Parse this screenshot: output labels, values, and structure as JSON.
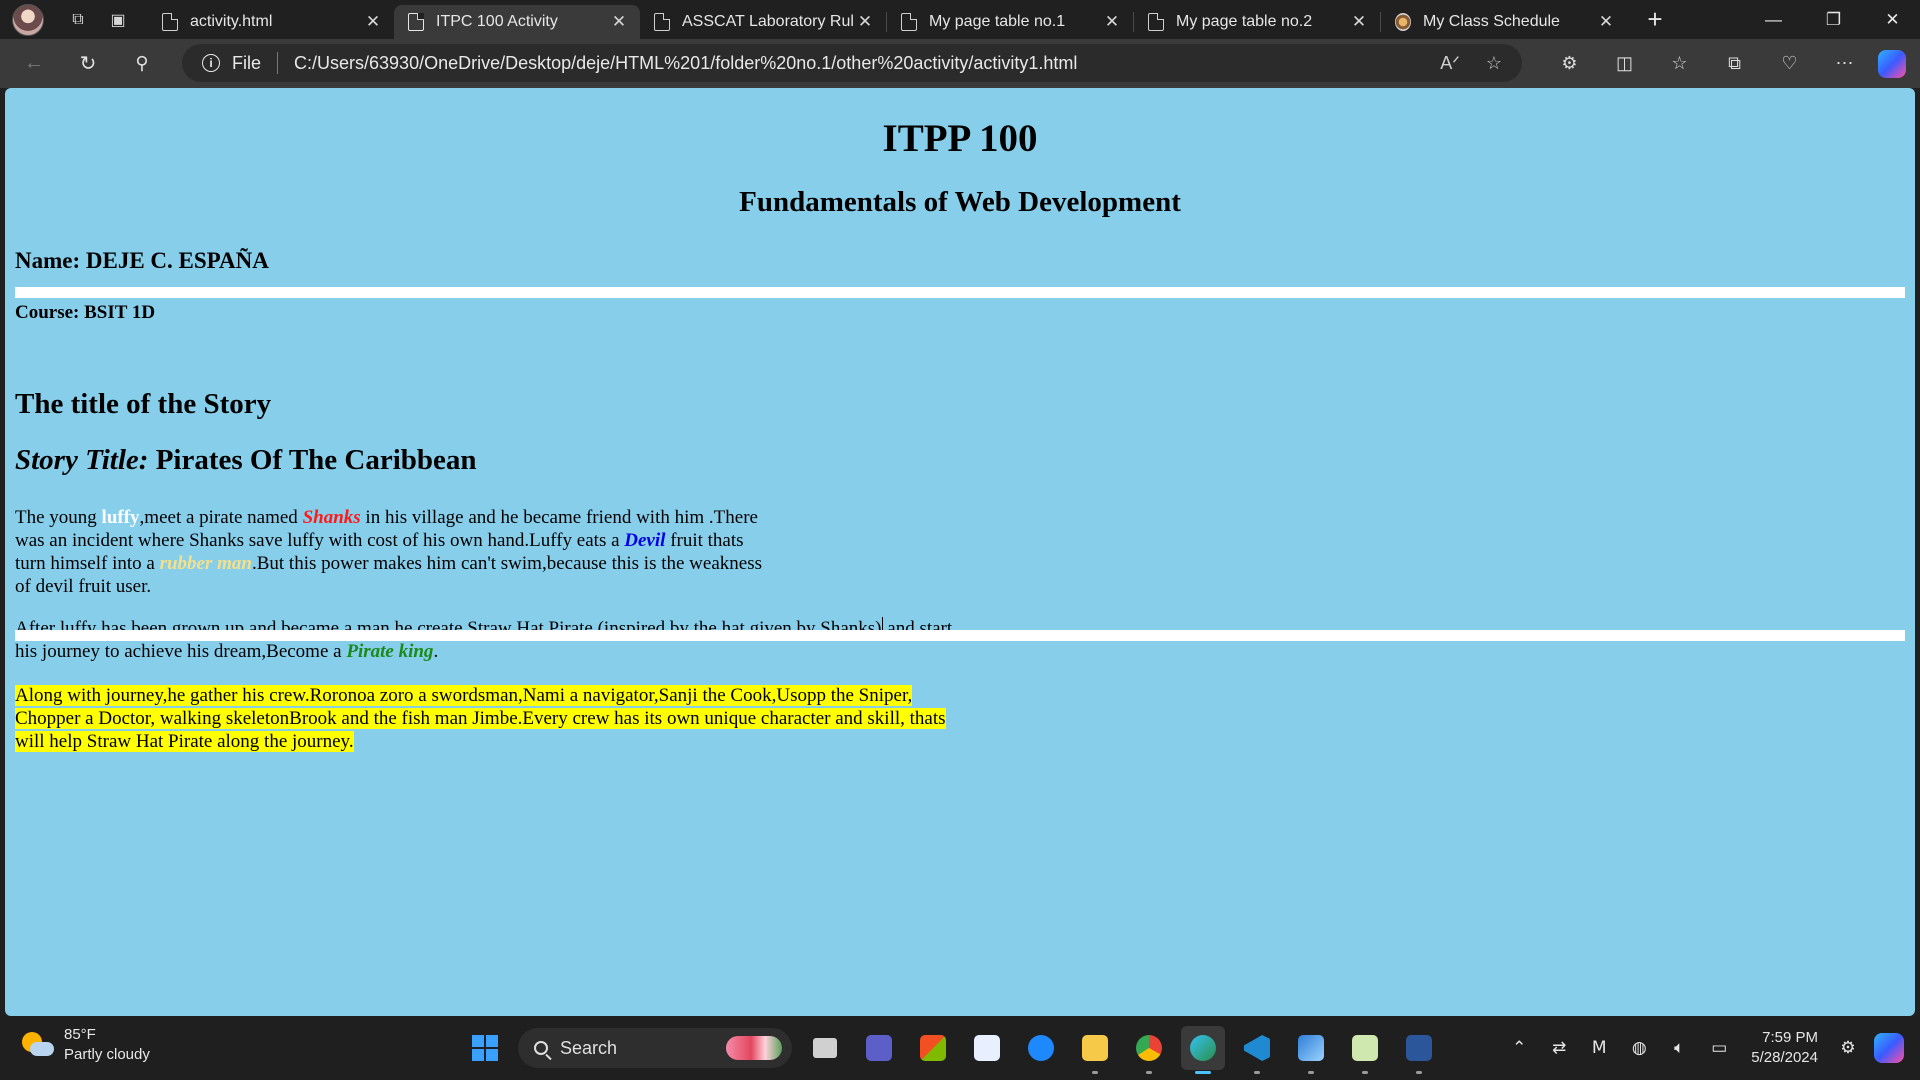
{
  "browser": {
    "tabs": [
      {
        "title": "activity.html",
        "active": false,
        "icon": "page-icon"
      },
      {
        "title": "ITPC 100 Activity",
        "active": true,
        "icon": "page-icon"
      },
      {
        "title": "ASSCAT Laboratory Rules",
        "active": false,
        "icon": "page-icon"
      },
      {
        "title": "My page table no.1",
        "active": false,
        "icon": "page-icon"
      },
      {
        "title": "My page table no.2",
        "active": false,
        "icon": "page-icon"
      },
      {
        "title": "My Class Schedule",
        "active": false,
        "icon": "globe-icon"
      }
    ],
    "address": {
      "scheme_label": "File",
      "url": "C:/Users/63930/OneDrive/Desktop/deje/HTML%201/folder%20no.1/other%20activity/activity1.html"
    }
  },
  "page": {
    "heading": "ITPP 100",
    "subheading": "Fundamentals of Web Development",
    "name_line": "Name: DEJE C. ESPAÑA",
    "course_line": "Course: BSIT 1D",
    "section_title": "The title of the Story",
    "story_title_label": "Story Title:",
    "story_title": "Pirates Of The Caribbean",
    "para1": {
      "t1": "The young ",
      "luffy": "luffy",
      "t2": ",meet a pirate named ",
      "shanks": "Shanks",
      "t3": " in his village and he became friend with him .There was an incident where Shanks save luffy with cost of his own hand.Luffy eats a ",
      "devil": "Devil",
      "t4": " fruit thats turn himself into a ",
      "rubber": "rubber man",
      "t5": ".But this power makes him can't swim,because this is the weakness of devil fruit user."
    },
    "para2": {
      "t1": "After luffy has been grown up and became a man,he create Straw Hat Pirate (inspired by the hat given by Shanks)",
      "t2": " and start his journey to achieve his dream,Become a ",
      "king": "Pirate king",
      "t3": "."
    },
    "para3": "Along with journey,he gather his crew.Roronoa zoro a swordsman,Nami a navigator,Sanji the Cook,Usopp the Sniper, Chopper a Doctor, walking skeletonBrook and the fish man Jimbe.Every crew has its own unique character and skill, thats will help Straw Hat Pirate along the journey.",
    "colors": {
      "background": "#87ceeb",
      "luffy": "#ffffff",
      "shanks": "#ff1a1a",
      "devil": "#0000e6",
      "rubber": "#f5e08a",
      "pirate_king": "#1a8a1a",
      "highlight": "#ffff00"
    }
  },
  "taskbar": {
    "weather_temp": "85°F",
    "weather_desc": "Partly cloudy",
    "search_label": "Search",
    "time": "7:59 PM",
    "date": "5/28/2024"
  }
}
